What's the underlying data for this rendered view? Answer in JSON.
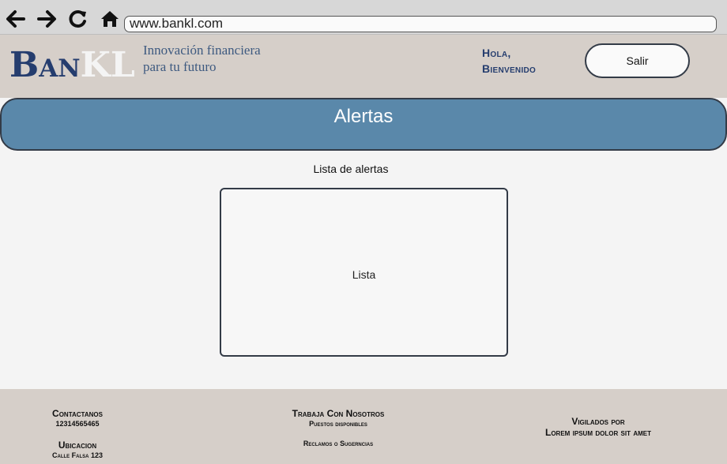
{
  "browser": {
    "url": "www.bankl.com",
    "icons": [
      "back-arrow-icon",
      "forward-arrow-icon",
      "reload-icon",
      "home-icon"
    ]
  },
  "header": {
    "logo_ban": "Ban",
    "logo_kl": "KL",
    "tagline": "Innovación financiera para tu futuro",
    "greeting_line1": "Hola,",
    "greeting_line2": "Bienvenido",
    "logout_label": "Salir"
  },
  "banner": {
    "title": "Alertas"
  },
  "main": {
    "subtitle": "Lista de alertas",
    "list_label": "Lista"
  },
  "footer": {
    "contact_heading": "Contactanos",
    "contact_phone": "12314565465",
    "location_heading": "Ubicacion",
    "location_address": "Calle Falsa 123",
    "work_heading": "Trabaja Con Nosotros",
    "work_positions": "Puestos disponibles",
    "claims": "Reclamos o Sugerncias",
    "supervised_heading": "Vigilados por",
    "supervised_text": "Lorem ipsum dolor sit amet"
  },
  "colors": {
    "banner_blue": "#5a88aa",
    "logo_navy": "#253d6e",
    "header_bg": "#d6cfc9",
    "page_bg": "#f4f4f4"
  }
}
